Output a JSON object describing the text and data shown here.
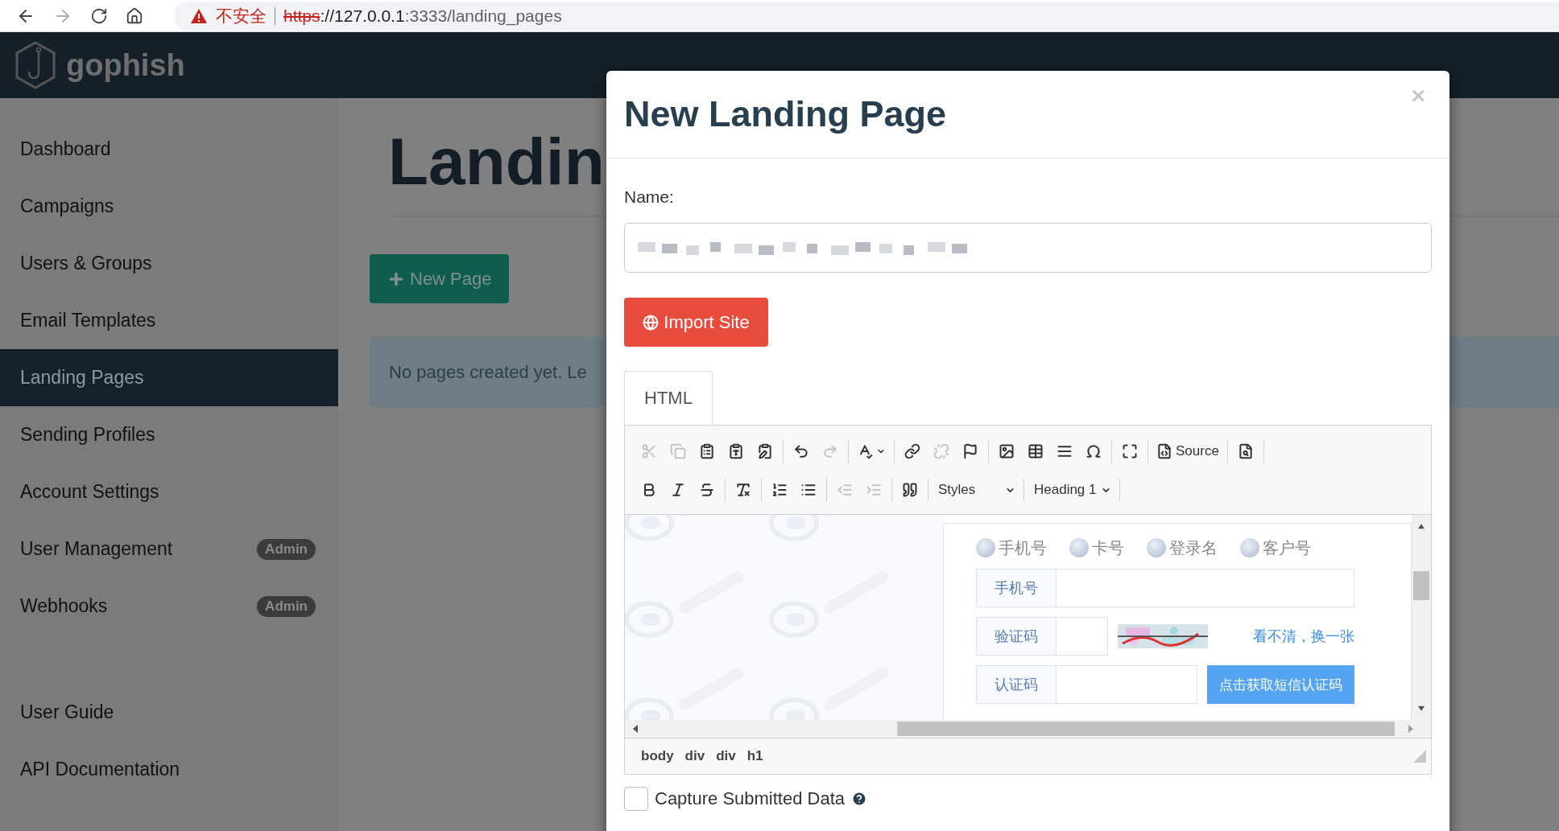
{
  "browser": {
    "back": {
      "disabled": false
    },
    "forward": {
      "disabled": true
    },
    "security_label": "不安全",
    "url": {
      "scheme": "https",
      "host": "://127.0.0.1",
      "path": ":3333/landing_pages"
    }
  },
  "navbar": {
    "brand": "gophish"
  },
  "sidebar": {
    "items": [
      {
        "label": "Dashboard",
        "selected": false
      },
      {
        "label": "Campaigns",
        "selected": false
      },
      {
        "label": "Users & Groups",
        "selected": false
      },
      {
        "label": "Email Templates",
        "selected": false
      },
      {
        "label": "Landing Pages",
        "selected": true
      },
      {
        "label": "Sending Profiles",
        "selected": false
      },
      {
        "label": "Account Settings",
        "selected": false
      },
      {
        "label": "User Management",
        "selected": false,
        "badge": "Admin"
      },
      {
        "label": "Webhooks",
        "selected": false,
        "badge": "Admin"
      }
    ],
    "footer_items": [
      {
        "label": "User Guide",
        "selected": false
      },
      {
        "label": "API Documentation",
        "selected": false
      }
    ]
  },
  "main": {
    "title": "Landin",
    "new_button": "New Page",
    "alert": "No pages created yet. Le"
  },
  "modal": {
    "title": "New Landing Page",
    "close": "×",
    "name_label": "Name:",
    "import_button": "Import Site",
    "tabs": [
      {
        "label": "HTML",
        "selected": true
      }
    ],
    "toolbar": [
      [
        {
          "kind": "icon",
          "disabled": true
        },
        {
          "kind": "icon",
          "disabled": true
        },
        {
          "kind": "icon",
          "disabled": false
        },
        {
          "kind": "icon",
          "disabled": false
        },
        {
          "kind": "icon",
          "disabled": false
        },
        {
          "kind": "separator"
        },
        {
          "kind": "icon",
          "disabled": false
        },
        {
          "kind": "icon",
          "disabled": true
        },
        {
          "kind": "separator"
        },
        {
          "kind": "icon-menu",
          "disabled": false
        },
        {
          "kind": "separator"
        },
        {
          "kind": "icon",
          "disabled": false
        },
        {
          "kind": "icon",
          "disabled": true
        },
        {
          "kind": "icon",
          "disabled": false
        },
        {
          "kind": "separator"
        },
        {
          "kind": "icon",
          "disabled": false
        },
        {
          "kind": "icon",
          "disabled": false
        },
        {
          "kind": "icon",
          "disabled": false
        },
        {
          "kind": "icon",
          "disabled": false
        },
        {
          "kind": "separator"
        },
        {
          "kind": "icon",
          "disabled": false
        },
        {
          "kind": "separator"
        },
        {
          "kind": "icon-text",
          "label": "Source",
          "disabled": false
        },
        {
          "kind": "separator"
        },
        {
          "kind": "icon",
          "disabled": false
        },
        {
          "kind": "separator"
        }
      ],
      [
        {
          "kind": "icon",
          "disabled": false
        },
        {
          "kind": "icon",
          "disabled": false
        },
        {
          "kind": "icon",
          "disabled": false
        },
        {
          "kind": "separator"
        },
        {
          "kind": "icon",
          "disabled": false
        },
        {
          "kind": "separator"
        },
        {
          "kind": "icon",
          "disabled": false
        },
        {
          "kind": "icon",
          "disabled": false
        },
        {
          "kind": "separator"
        },
        {
          "kind": "icon",
          "disabled": true
        },
        {
          "kind": "icon",
          "disabled": true
        },
        {
          "kind": "separator"
        },
        {
          "kind": "icon",
          "disabled": false
        },
        {
          "kind": "separator"
        },
        {
          "kind": "dropdown",
          "label": "Styles",
          "disabled": false
        },
        {
          "kind": "separator"
        },
        {
          "kind": "dropdown",
          "label": "Heading 1",
          "disabled": false
        },
        {
          "kind": "separator"
        }
      ]
    ],
    "preview": {
      "radios": [
        {
          "label": "手机号",
          "selected": false
        },
        {
          "label": "卡号",
          "selected": false
        },
        {
          "label": "登录名",
          "selected": false
        },
        {
          "label": "客户号",
          "selected": false
        }
      ],
      "phone_label": "手机号",
      "captcha_label": "验证码",
      "refresh_link": "看不清，换一张",
      "sms_label": "认证码",
      "sms_button": "点击获取短信认证码"
    },
    "elements_path": [
      "body",
      "div",
      "div",
      "h1"
    ],
    "capture": {
      "label": "Capture Submitted Data",
      "checked": false
    }
  }
}
